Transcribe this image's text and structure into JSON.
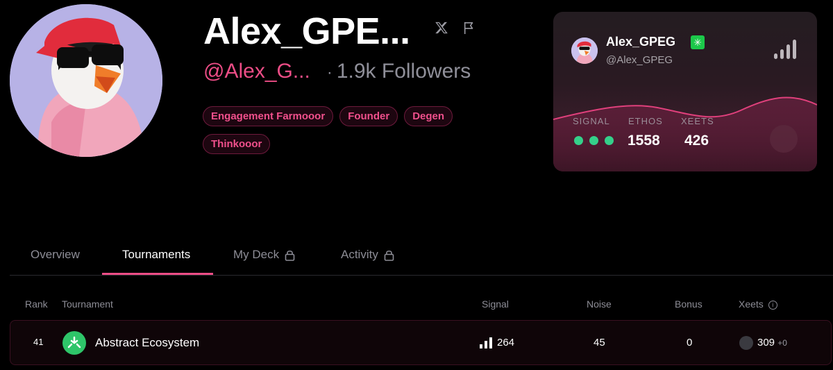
{
  "profile": {
    "name": "Alex_GPE...",
    "handle": "@Alex_G...",
    "separator": "·",
    "followers": "1.9k Followers",
    "tags": [
      "Engagement Farmooor",
      "Founder",
      "Degen",
      "Thinkooor"
    ]
  },
  "card": {
    "name": "Alex_GPEG",
    "verified_glyph": "✳",
    "handle": "@Alex_GPEG",
    "signal_label": "SIGNAL",
    "ethos_label": "ETHOS",
    "ethos_value": "1558",
    "xeets_label": "XEETS",
    "xeets_value": "426",
    "signal_dots": 3,
    "colors": {
      "accent": "#ec4d86",
      "signal_dot": "#35d08a",
      "verified": "#1cc84a"
    }
  },
  "tabs": [
    {
      "label": "Overview",
      "locked": false,
      "active": false
    },
    {
      "label": "Tournaments",
      "locked": false,
      "active": true
    },
    {
      "label": "My Deck",
      "locked": true,
      "active": false
    },
    {
      "label": "Activity",
      "locked": true,
      "active": false
    }
  ],
  "table": {
    "headers": {
      "rank": "Rank",
      "tournament": "Tournament",
      "signal": "Signal",
      "noise": "Noise",
      "bonus": "Bonus",
      "xeets": "Xeets"
    },
    "rows": [
      {
        "rank": "41",
        "tournament": "Abstract Ecosystem",
        "signal": "264",
        "noise": "45",
        "bonus": "0",
        "xeets": "309",
        "xeets_delta": "+0"
      }
    ]
  }
}
